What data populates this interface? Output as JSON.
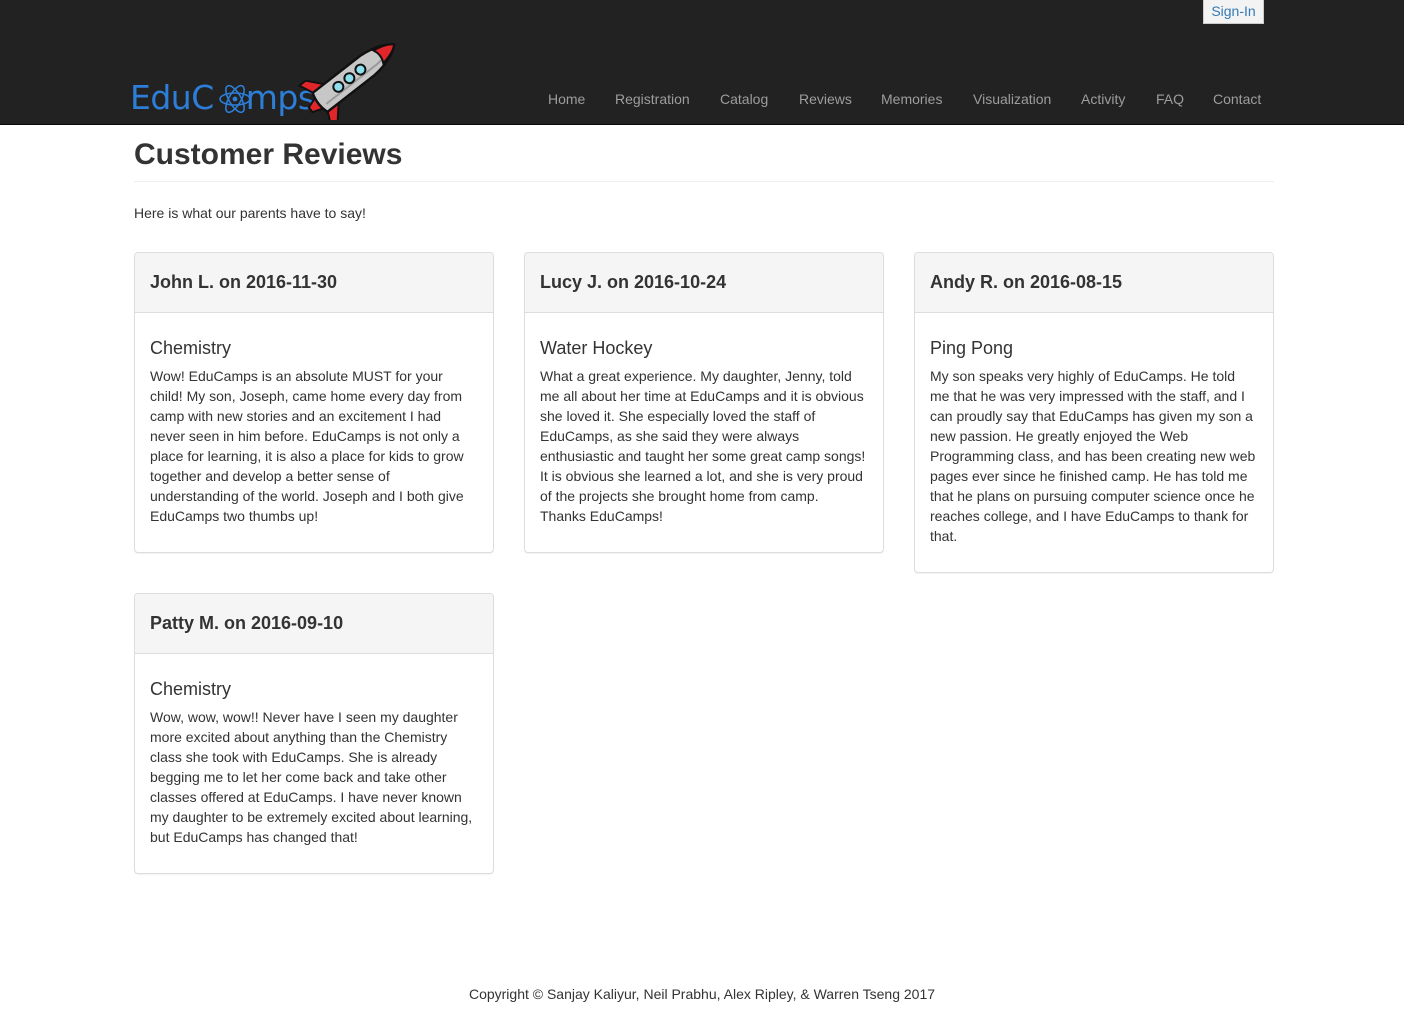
{
  "header": {
    "signin_label": "Sign-In",
    "brand": {
      "text_left": "EduC",
      "text_right": "mps"
    },
    "nav": [
      "Home",
      "Registration",
      "Catalog",
      "Reviews",
      "Memories",
      "Visualization",
      "Activity",
      "FAQ",
      "Contact"
    ]
  },
  "main": {
    "title": "Customer Reviews",
    "intro": "Here is what our parents have to say!",
    "reviews": [
      {
        "heading": "John L. on 2016-11-30",
        "camp": "Chemistry",
        "text": "Wow! EduCamps is an absolute MUST for your child! My son, Joseph, came home every day from camp with new stories and an excitement I had never seen in him before. EduCamps is not only a place for learning, it is also a place for kids to grow together and develop a better sense of understanding of the world. Joseph and I both give EduCamps two thumbs up!"
      },
      {
        "heading": "Lucy J. on 2016-10-24",
        "camp": "Water Hockey",
        "text": "What a great experience. My daughter, Jenny, told me all about her time at EduCamps and it is obvious she loved it. She especially loved the staff of EduCamps, as she said they were always enthusiastic and taught her some great camp songs! It is obvious she learned a lot, and she is very proud of the projects she brought home from camp. Thanks EduCamps!"
      },
      {
        "heading": "Andy R. on 2016-08-15",
        "camp": "Ping Pong",
        "text": "My son speaks very highly of EduCamps. He told me that he was very impressed with the staff, and I can proudly say that EduCamps has given my son a new passion. He greatly enjoyed the Web Programming class, and has been creating new web pages ever since he finished camp. He has told me that he plans on pursuing computer science once he reaches college, and I have EduCamps to thank for that."
      },
      {
        "heading": "Patty M. on 2016-09-10",
        "camp": "Chemistry",
        "text": "Wow, wow, wow!! Never have I seen my daughter more excited about anything than the Chemistry class she took with EduCamps. She is already begging me to let her come back and take other classes offered at EduCamps. I have never known my daughter to be extremely excited about learning, but EduCamps has changed that!"
      }
    ]
  },
  "footer": {
    "copyright": "Copyright © Sanjay Kaliyur, Neil Prabhu, Alex Ripley, & Warren Tseng 2017"
  },
  "colors": {
    "navbar_bg": "#222222",
    "nav_text": "#9d9d9d",
    "link": "#337ab7",
    "brand_blue": "#2d7ed8",
    "rocket_red": "#e0262b",
    "panel_heading_bg": "#f5f5f5"
  },
  "icons": [
    "atom-icon",
    "rocket-logo"
  ]
}
